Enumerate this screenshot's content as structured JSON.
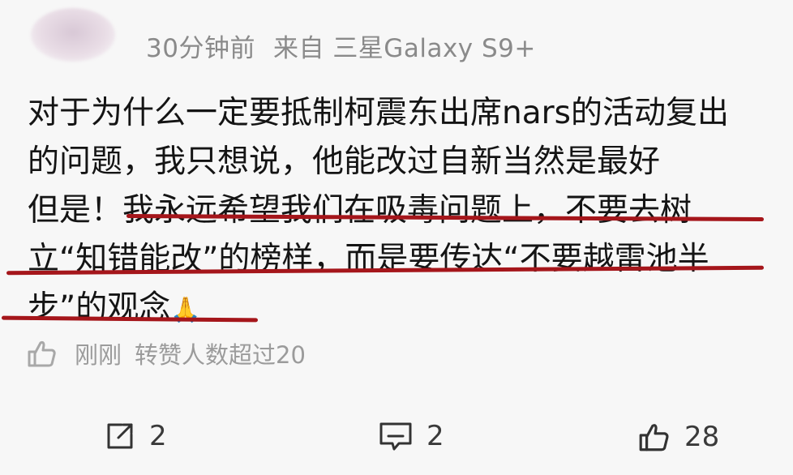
{
  "header": {
    "time": "30分钟前",
    "source_prefix": "来自",
    "device": "三星Galaxy S9+"
  },
  "comment": {
    "lines": [
      "对于为什么一定要抵制柯震东出席nars的活动复出",
      "的问题，我只想说，他能改过自新当然是最好",
      "但是！我永远希望我们在吸毒问题上，不要去树",
      "立“知错能改”的榜样，而是要传达“不要越雷池半",
      "步”的观念"
    ],
    "emoji": "🙏"
  },
  "status": {
    "time": "刚刚",
    "text": "转赞人数超过20"
  },
  "actions": {
    "share_count": "2",
    "comment_count": "2",
    "like_count": "28"
  },
  "colors": {
    "underline": "#a5161b",
    "meta_text": "#8a8a8a"
  }
}
